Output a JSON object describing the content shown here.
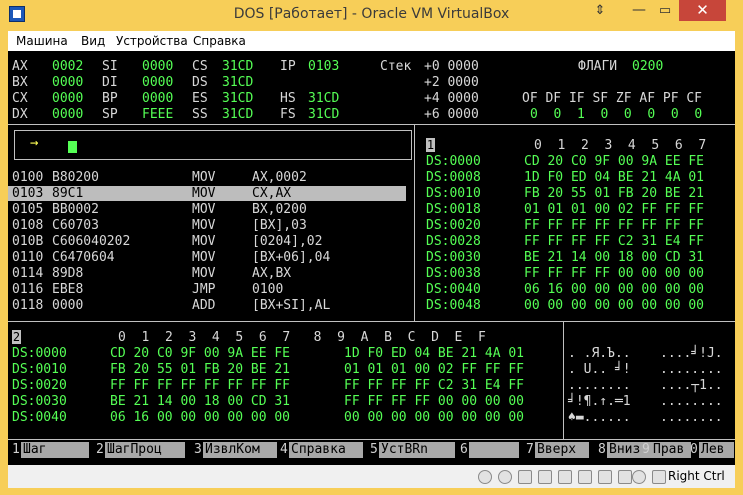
{
  "window": {
    "title": "DOS [Работает] - Oracle VM VirtualBox",
    "pin_glyph": "⇕",
    "min_glyph": "—",
    "max_glyph": "▭",
    "close_glyph": "✕"
  },
  "menu": [
    "Машина",
    "Вид",
    "Устройства",
    "Справка"
  ],
  "registers": {
    "row0": [
      "AX",
      "0002",
      "SI",
      "0000",
      "CS",
      "31CD",
      "IP",
      "0103"
    ],
    "row1": [
      "BX",
      "0000",
      "DI",
      "0000",
      "DS",
      "31CD"
    ],
    "row2": [
      "CX",
      "0000",
      "BP",
      "0000",
      "ES",
      "31CD",
      "HS",
      "31CD"
    ],
    "row3": [
      "DX",
      "0000",
      "SP",
      "FEEE",
      "SS",
      "31CD",
      "FS",
      "31CD"
    ]
  },
  "stack": {
    "label": "Стек",
    "rows": [
      "+0 0000",
      "+2 0000",
      "+4 0000",
      "+6 0000"
    ]
  },
  "flags": {
    "label": "ФЛАГИ",
    "value": "0200",
    "names": "OF DF IF SF ZF AF PF CF",
    "values": "0  0  1  0  0  0  0  0"
  },
  "command_prompt": "→",
  "disasm": [
    [
      "0100",
      "B80200",
      "MOV",
      "AX,0002"
    ],
    [
      "0103",
      "89C1",
      "MOV",
      "CX,AX"
    ],
    [
      "0105",
      "BB0002",
      "MOV",
      "BX,0200"
    ],
    [
      "0108",
      "C60703",
      "MOV",
      "[BX],03"
    ],
    [
      "010B",
      "C606040202",
      "MOV",
      "[0204],02"
    ],
    [
      "0110",
      "C6470604",
      "MOV",
      "[BX+06],04"
    ],
    [
      "0114",
      "89D8",
      "MOV",
      "AX,BX"
    ],
    [
      "0116",
      "EBE8",
      "JMP",
      "0100"
    ],
    [
      "0118",
      "0000",
      "ADD",
      "[BX+SI],AL"
    ]
  ],
  "dump1": {
    "badge": "1",
    "header": "0  1  2  3  4  5  6  7",
    "rows": [
      [
        "DS:0000",
        "CD 20 C0 9F 00 9A EE FE"
      ],
      [
        "DS:0008",
        "1D F0 ED 04 BE 21 4A 01"
      ],
      [
        "DS:0010",
        "FB 20 55 01 FB 20 BE 21"
      ],
      [
        "DS:0018",
        "01 01 01 00 02 FF FF FF"
      ],
      [
        "DS:0020",
        "FF FF FF FF FF FF FF FF"
      ],
      [
        "DS:0028",
        "FF FF FF FF C2 31 E4 FF"
      ],
      [
        "DS:0030",
        "BE 21 14 00 18 00 CD 31"
      ],
      [
        "DS:0038",
        "FF FF FF FF 00 00 00 00"
      ],
      [
        "DS:0040",
        "06 16 00 00 00 00 00 00"
      ],
      [
        "DS:0048",
        "00 00 00 00 00 00 00 00"
      ]
    ]
  },
  "dump2": {
    "badge": "2",
    "header": "0  1  2  3  4  5  6  7   8  9  A  B  C  D  E  F",
    "rows": [
      [
        "DS:0000",
        "CD 20 C0 9F 00 9A EE FE",
        "1D F0 ED 04 BE 21 4A 01",
        ". .Я.Ъ..",
        "....╛!J."
      ],
      [
        "DS:0010",
        "FB 20 55 01 FB 20 BE 21",
        "01 01 01 00 02 FF FF FF",
        ". U.. ╛!",
        "........"
      ],
      [
        "DS:0020",
        "FF FF FF FF FF FF FF FF",
        "FF FF FF FF C2 31 E4 FF",
        "........",
        "....┬1.."
      ],
      [
        "DS:0030",
        "BE 21 14 00 18 00 CD 31",
        "FF FF FF FF 00 00 00 00",
        "╛!¶.↑.═1",
        "........"
      ],
      [
        "DS:0040",
        "06 16 00 00 00 00 00 00",
        "00 00 00 00 00 00 00 00",
        "♠▬......",
        "........"
      ]
    ]
  },
  "fkeys": [
    [
      "1",
      "Шаг"
    ],
    [
      "2",
      "ШагПроц"
    ],
    [
      "3",
      "ИзвлКом"
    ],
    [
      "4",
      "Справка"
    ],
    [
      "5",
      "УстBRn"
    ],
    [
      "6",
      ""
    ],
    [
      "7",
      "Вверх"
    ],
    [
      "8",
      "Вниз"
    ],
    [
      "9",
      "Прав"
    ],
    [
      "0",
      "Лев"
    ]
  ],
  "status": {
    "host_key": "Right Ctrl"
  }
}
